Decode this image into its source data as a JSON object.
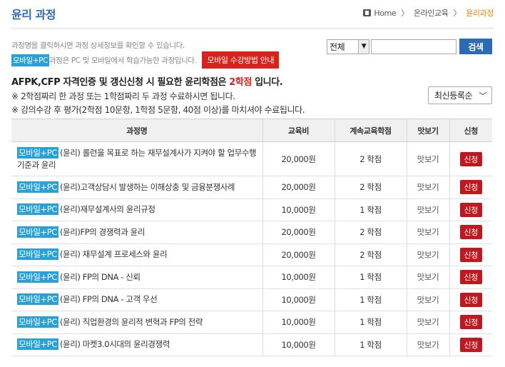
{
  "header": {
    "title": "윤리 과정",
    "breadcrumb": [
      "Home",
      "온라인교육",
      "윤리과정"
    ]
  },
  "info": {
    "line1": "과정명을 클릭하시면 과정 상세정보를 확인할 수 있습니다.",
    "tag": "모바일+PC",
    "line2": "과정은 PC 및 모바일에서 학습가능한 과정입니다.",
    "guide_button": "모바일 수강방법 안내"
  },
  "search": {
    "select_value": "전체",
    "input_value": "",
    "button_label": "검색"
  },
  "notice": {
    "prefix": "AFPK,CFP 자격인증 및 갱신신청 시 필요한 윤리학점은 ",
    "highlight": "2학점",
    "suffix": " 입니다.",
    "note1": "※ 2학점짜리 한 과정 또는 1학점짜리 두 과정 수료하시면 됩니다.",
    "note2": "※ 강의수강 후 평가(2학점 10문항, 1학점 5문항, 40점 이상)를 마치셔야 수료됩니다."
  },
  "sort": {
    "selected": "최신등록순"
  },
  "table": {
    "headers": [
      "과정명",
      "교육비",
      "계속교육학점",
      "맛보기",
      "신청"
    ],
    "rows": [
      {
        "tag": "모바일+PC",
        "title": "(윤리) 롤런을 목표로 하는 재무설계사가 지켜야 할 업무수행기준과 윤리",
        "fee": "20,000원",
        "credit": "2 학점",
        "preview": "맛보기",
        "apply": "신청"
      },
      {
        "tag": "모바일+PC",
        "title": "(윤리)고객상담시 발생하는 이해상충 및 금융분쟁사례",
        "fee": "20,000원",
        "credit": "2 학점",
        "preview": "맛보기",
        "apply": "신청"
      },
      {
        "tag": "모바일+PC",
        "title": "(윤리)재무설계사의 윤리규정",
        "fee": "10,000원",
        "credit": "1 학점",
        "preview": "맛보기",
        "apply": "신청"
      },
      {
        "tag": "모바일+PC",
        "title": "(윤리)FP의 경쟁력과 윤리",
        "fee": "20,000원",
        "credit": "2 학점",
        "preview": "맛보기",
        "apply": "신청"
      },
      {
        "tag": "모바일+PC",
        "title": "(윤리) 재무설계 프로세스와 윤리",
        "fee": "20,000원",
        "credit": "2 학점",
        "preview": "맛보기",
        "apply": "신청"
      },
      {
        "tag": "모바일+PC",
        "title": "(윤리) FP의 DNA - 신뢰",
        "fee": "10,000원",
        "credit": "1 학점",
        "preview": "맛보기",
        "apply": "신청"
      },
      {
        "tag": "모바일+PC",
        "title": "(윤리) FP의 DNA - 고객 우선",
        "fee": "10,000원",
        "credit": "1 학점",
        "preview": "맛보기",
        "apply": "신청"
      },
      {
        "tag": "모바일+PC",
        "title": "(윤리) 직업환경의 윤리적 변혁과 FP의 전략",
        "fee": "10,000원",
        "credit": "1 학점",
        "preview": "맛보기",
        "apply": "신청"
      },
      {
        "tag": "모바일+PC",
        "title": "(윤리) 마켓3.0시대의 윤리경쟁력",
        "fee": "10,000원",
        "credit": "1 학점",
        "preview": "맛보기",
        "apply": "신청"
      }
    ]
  }
}
